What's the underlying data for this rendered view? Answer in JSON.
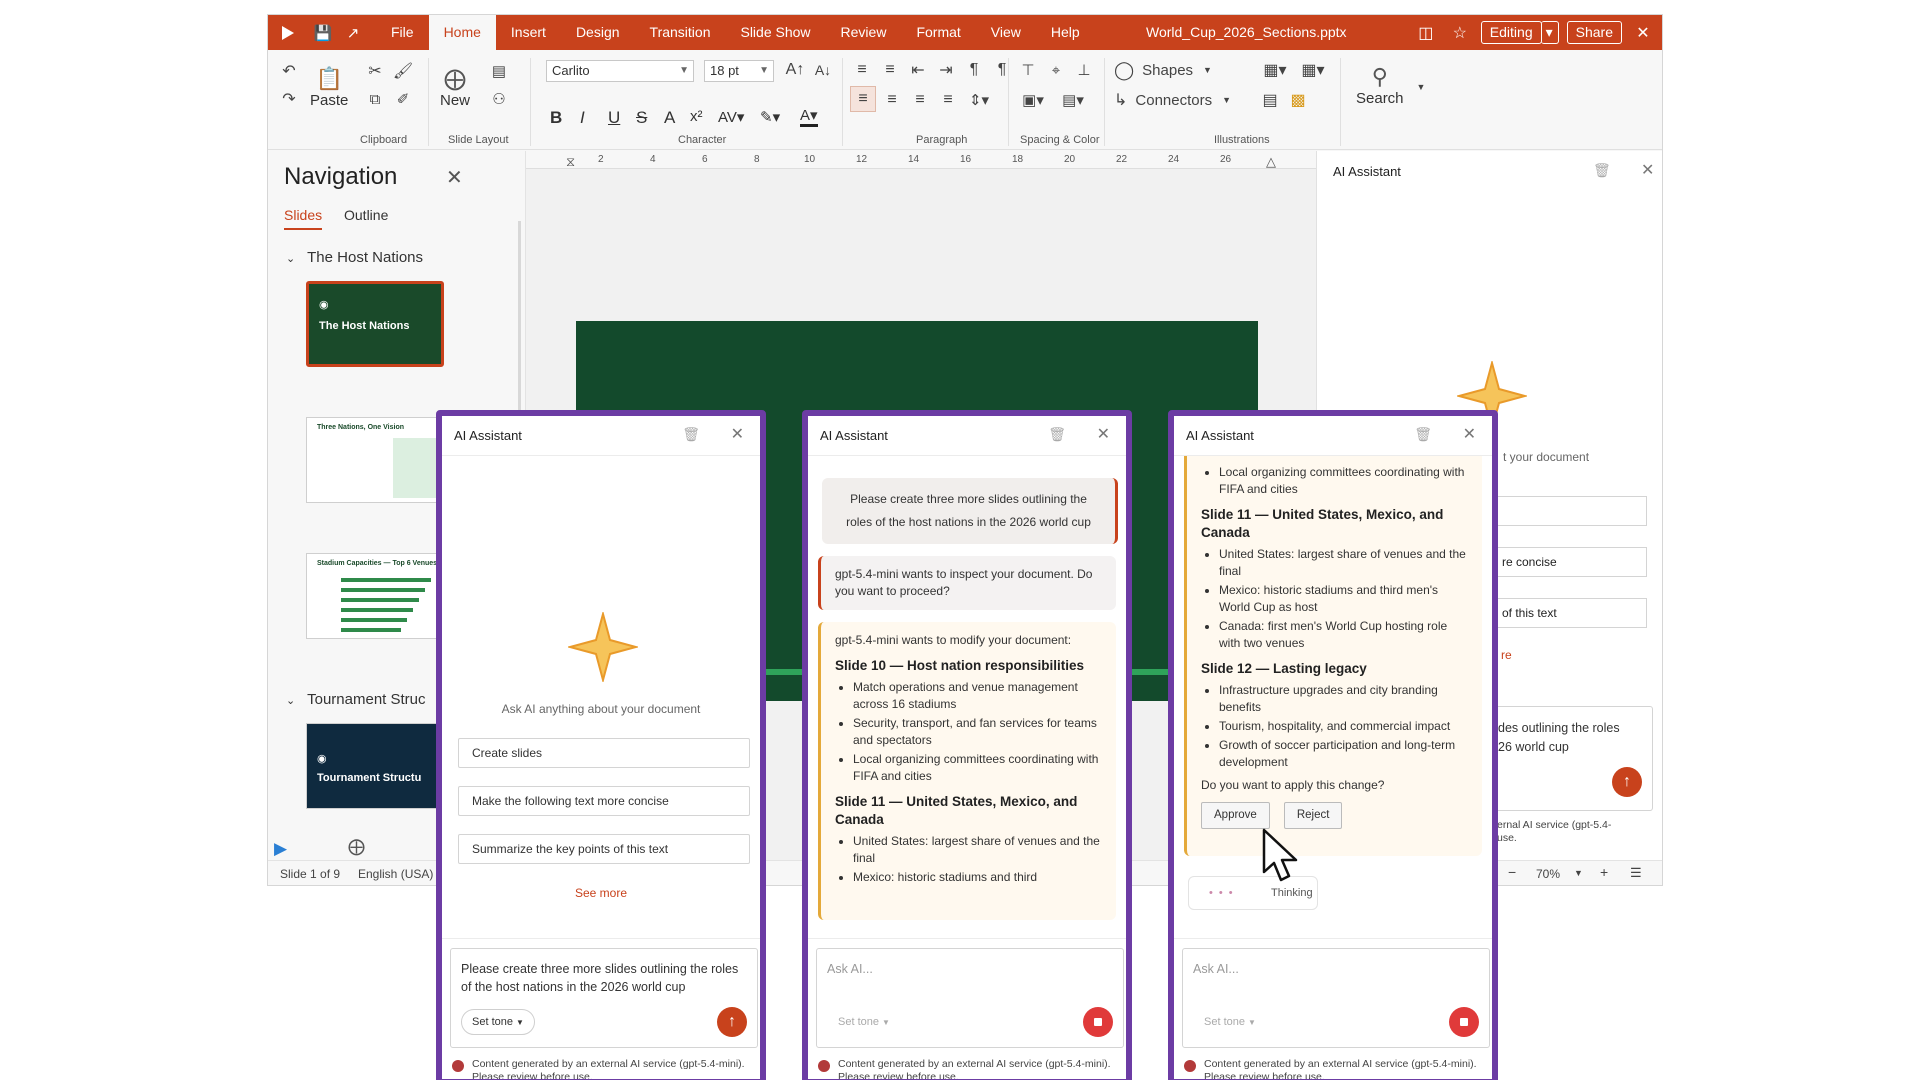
{
  "app": {
    "doc_title": "World_Cup_2026_Sections.pptx",
    "menu": [
      "File",
      "Home",
      "Insert",
      "Design",
      "Transition",
      "Slide Show",
      "Review",
      "Format",
      "View",
      "Help"
    ],
    "editing_label": "Editing",
    "share_label": "Share"
  },
  "ribbon": {
    "paste": "Paste",
    "new": "New",
    "font_name": "Carlito",
    "font_size": "18 pt",
    "shapes": "Shapes",
    "connectors": "Connectors",
    "search": "Search",
    "groups": {
      "clipboard": "Clipboard",
      "slide_layout": "Slide Layout",
      "character": "Character",
      "paragraph": "Paragraph",
      "spacing_color": "Spacing & Color",
      "illustrations": "Illustrations"
    }
  },
  "navigation": {
    "title": "Navigation",
    "tabs": [
      "Slides",
      "Outline"
    ],
    "section1": "The Host Nations",
    "section2": "Tournament Struc",
    "thumb1_title": "The Host Nations",
    "thumb2_title": "Three Nations, One Vision",
    "thumb3_title": "Stadium Capacities — Top 6 Venues",
    "thumb4_title": "Tournament Structu"
  },
  "ruler": [
    "2",
    "4",
    "6",
    "8",
    "10",
    "12",
    "14",
    "16",
    "18",
    "20",
    "22",
    "24",
    "26"
  ],
  "statusbar": {
    "slide_of": "Slide 1 of 9",
    "language": "English (USA)",
    "zoom": "70%"
  },
  "ai_bg": {
    "title": "AI Assistant",
    "hint_partial": "t your document",
    "sugg2_partial": "re concise",
    "sugg3_partial": "of this text",
    "more_partial": "re",
    "input_partial": "des outlining the roles\n26 world cup",
    "disc_partial": "ernal AI service (gpt-5.4-\nuse."
  },
  "panel1": {
    "title": "AI Assistant",
    "hint": "Ask AI anything about your document",
    "suggestions": [
      "Create slides",
      "Make the following text more concise",
      "Summarize the key points of this text"
    ],
    "see_more": "See more",
    "input_text": "Please create three more slides outlining the roles of the host nations in the 2026 world cup",
    "tone": "Set tone",
    "disclaimer": "Content generated by an external AI service (gpt-5.4-mini). Please review before use."
  },
  "panel2": {
    "title": "AI Assistant",
    "user_msg": "Please create three more slides outlining the roles of the host nations in the 2026 world cup",
    "inspect_msg": "gpt-5.4-mini wants to inspect your document. Do you want to proceed?",
    "modify_msg": "gpt-5.4-mini wants to modify your document:",
    "slides": [
      {
        "title": "Slide 10 — Host nation responsibilities",
        "bullets": [
          "Match operations and venue management across 16 stadiums",
          "Security, transport, and fan services for teams and spectators",
          "Local organizing committees coordinating with FIFA and cities"
        ]
      },
      {
        "title": "Slide 11 — United States, Mexico, and Canada",
        "bullets": [
          "United States: largest share of venues and the final",
          "Mexico: historic stadiums and third"
        ]
      }
    ],
    "placeholder": "Ask AI...",
    "tone": "Set tone",
    "disclaimer": "Content generated by an external AI service (gpt-5.4-mini). Please review before use."
  },
  "panel3": {
    "title": "AI Assistant",
    "top_bullets": [
      "Local organizing committees coordinating with FIFA and cities"
    ],
    "slides": [
      {
        "title": "Slide 11 — United States, Mexico, and Canada",
        "bullets": [
          "United States: largest share of venues and the final",
          "Mexico: historic stadiums and third men's World Cup as host",
          "Canada: first men's World Cup hosting role with two venues"
        ]
      },
      {
        "title": "Slide 12 — Lasting legacy",
        "bullets": [
          "Infrastructure upgrades and city branding benefits",
          "Tourism, hospitality, and commercial impact",
          "Growth of soccer participation and long-term development"
        ]
      }
    ],
    "question": "Do you want to apply this change?",
    "approve": "Approve",
    "reject": "Reject",
    "thinking": "Thinking",
    "placeholder": "Ask AI...",
    "tone": "Set tone",
    "disclaimer": "Content generated by an external AI service (gpt-5.4-mini). Please review before use."
  },
  "colors": {
    "accent": "#c8421c",
    "panel_border": "#6c3ca4",
    "slide_green": "#134a2c",
    "star": "#f0b03c"
  }
}
